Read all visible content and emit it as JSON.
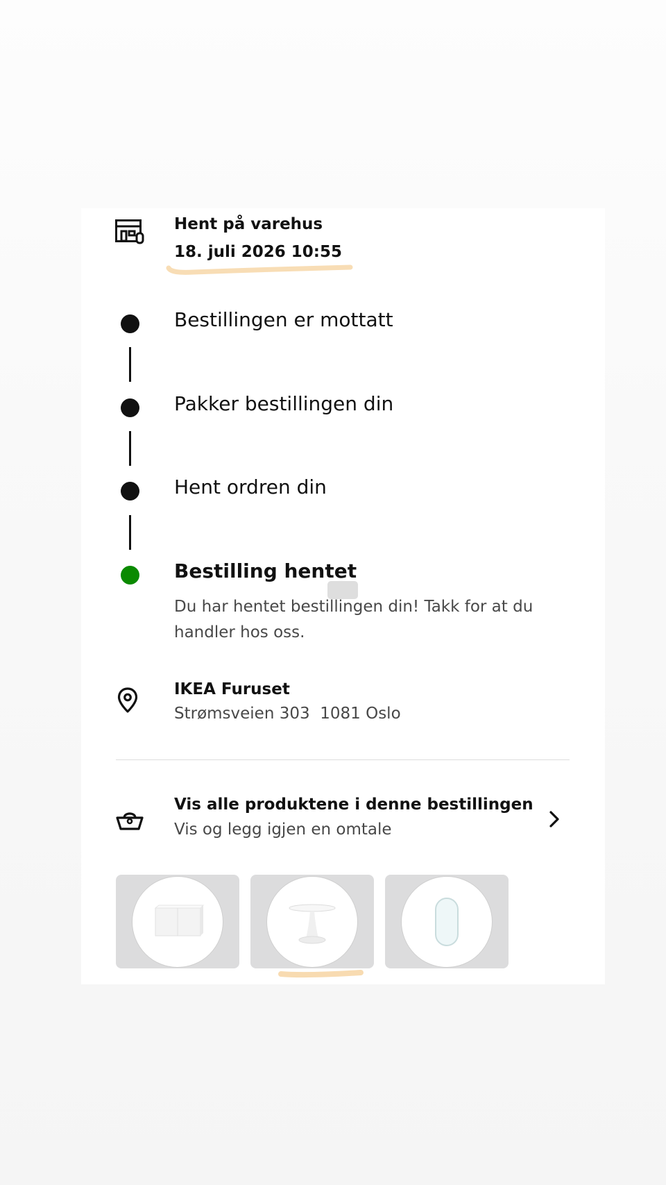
{
  "pickup": {
    "title": "Hent på varehus",
    "datetime": "18. juli 2026 10:55",
    "icon": "store-icon"
  },
  "timeline": {
    "steps": [
      {
        "label": "Bestillingen er mottatt",
        "status": "done"
      },
      {
        "label": "Pakker bestillingen din",
        "status": "done"
      },
      {
        "label": "Hent ordren din",
        "status": "done"
      },
      {
        "label": "Bestilling hentet",
        "status": "current",
        "description": "Du har hentet bestillingen din! Takk for at du handler hos oss."
      }
    ],
    "colors": {
      "done": "#111111",
      "current": "#0a8a00"
    }
  },
  "store": {
    "icon": "location-pin-icon",
    "name": "IKEA Furuset",
    "address": "Strømsveien 303  1081 Oslo"
  },
  "products": {
    "icon": "basket-icon",
    "title": "Vis alle produktene i denne bestillingen",
    "subtitle": "Vis og legg igjen en omtale",
    "chevron": "chevron-right-icon",
    "thumbnails": [
      {
        "name": "white-cabinet"
      },
      {
        "name": "white-pedestal-table"
      },
      {
        "name": "oval-mirror"
      }
    ]
  },
  "annotations": {
    "highlight_color": "#f7d7a8"
  }
}
